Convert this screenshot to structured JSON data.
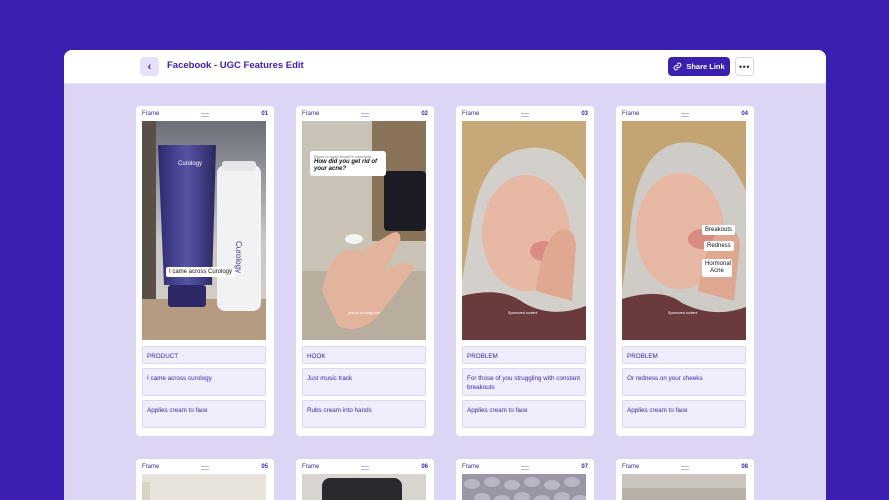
{
  "header": {
    "back_icon": "chevron-left-icon",
    "title": "Facebook - UGC Features Edit",
    "share_label": "Share Link",
    "share_icon": "link-icon",
    "more_icon": "more-horizontal-icon",
    "more_glyph": "•••",
    "back_glyph": "‹"
  },
  "frames": [
    {
      "label": "Frame",
      "number": "01",
      "tag": "PRODUCT",
      "audio": "I came across curology",
      "action": "Applies cream to face",
      "overlay": [
        "I came across Curology"
      ],
      "brand": "Curology"
    },
    {
      "label": "Frame",
      "number": "02",
      "tag": "HOOK",
      "audio": "Just music track",
      "action": "Rubs cream into hands",
      "reply": "Reply to noah.lewis9's comment",
      "question": "How did you get rid of your acne?",
      "caption": "person curology.com"
    },
    {
      "label": "Frame",
      "number": "03",
      "tag": "PROBLEM",
      "audio": "For those of you struggling with constant breakouts",
      "action": "Applies cream to face",
      "caption": "Sponsored content"
    },
    {
      "label": "Frame",
      "number": "04",
      "tag": "PROBLEM",
      "audio": "Or redness on your cheeks",
      "action": "Applies cream to face",
      "overlay": [
        "Breakouts",
        "Redness",
        "Hormonal Acne"
      ],
      "caption": "Sponsored content"
    },
    {
      "label": "Frame",
      "number": "05"
    },
    {
      "label": "Frame",
      "number": "06"
    },
    {
      "label": "Frame",
      "number": "07"
    },
    {
      "label": "Frame",
      "number": "08"
    }
  ],
  "colors": {
    "brand": "#3d1fb0",
    "canvas": "#dcd6f4",
    "field": "#efedfb"
  }
}
